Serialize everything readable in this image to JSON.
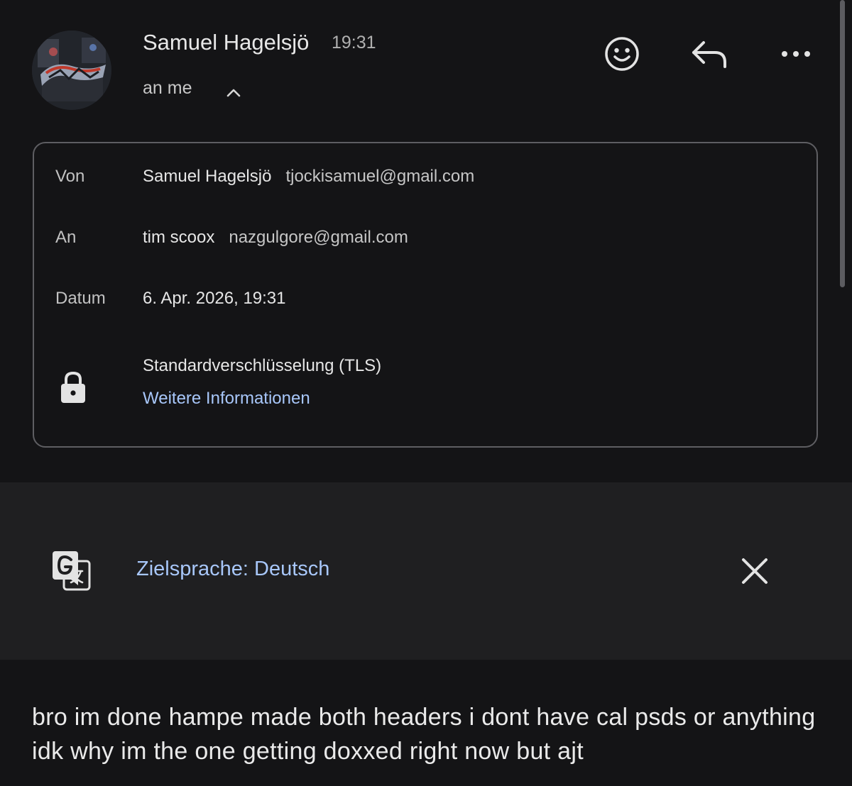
{
  "sender": {
    "name": "Samuel Hagelsjö",
    "time": "19:31",
    "recipients_summary": "an me",
    "avatar_icon": "avatar-graffiti-image"
  },
  "actions": {
    "emoji_icon": "smiley-icon",
    "reply_icon": "reply-icon",
    "more_icon": "more-horizontal-icon"
  },
  "details": {
    "from_label": "Von",
    "from_name": "Samuel Hagelsjö",
    "from_email": "tjockisamuel@gmail.com",
    "to_label": "An",
    "to_name": "tim scoox",
    "to_email": "nazgulgore@gmail.com",
    "date_label": "Datum",
    "date_value": "6. Apr. 2026, 19:31",
    "encryption": "Standardverschlüsselung (TLS)",
    "more_info_link": "Weitere Informationen"
  },
  "translate": {
    "label": "Zielsprache: Deutsch"
  },
  "message": {
    "body": "bro im done hampe made both headers i dont have cal psds or anything idk why im the one getting doxxed right now but ajt"
  },
  "colors": {
    "background": "#141416",
    "translate_bar": "#1f1f21",
    "link": "#a8c7fa",
    "border": "#5e5e62"
  }
}
